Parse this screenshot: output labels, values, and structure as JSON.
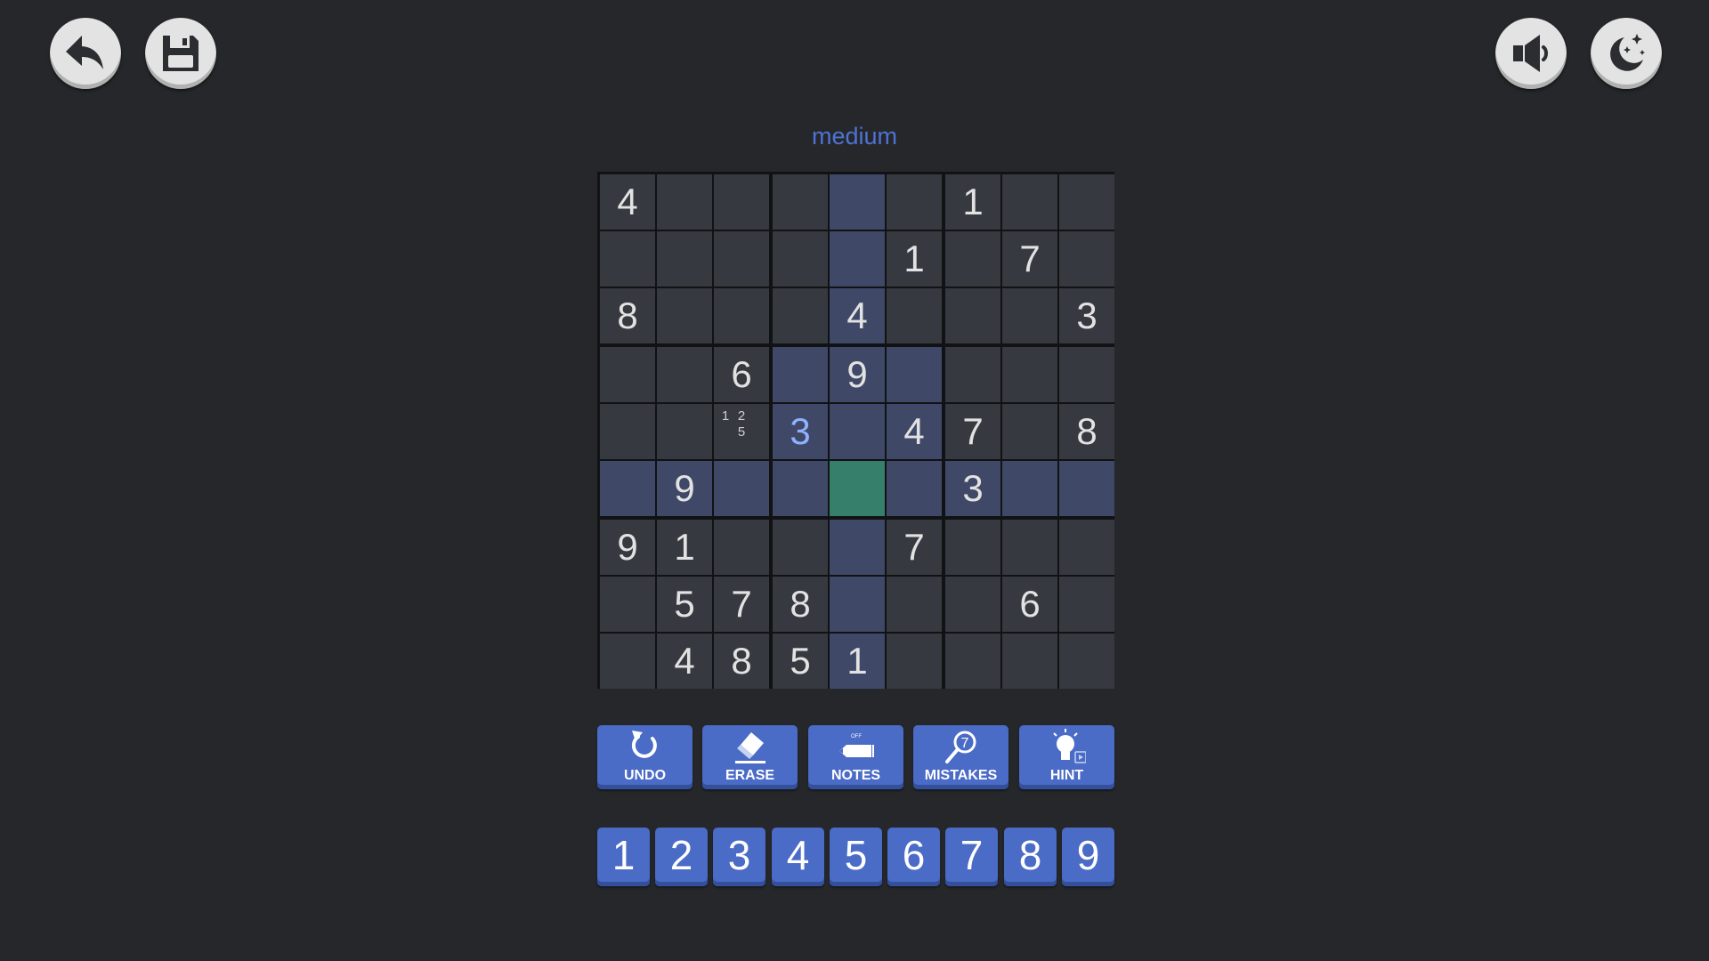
{
  "difficulty": "medium",
  "top_buttons": {
    "left": [
      {
        "name": "back-button",
        "icon": "back-arrow-icon"
      },
      {
        "name": "save-button",
        "icon": "floppy-disk-icon"
      }
    ],
    "right": [
      {
        "name": "sound-button",
        "icon": "speaker-icon"
      },
      {
        "name": "night-mode-button",
        "icon": "moon-stars-icon"
      }
    ]
  },
  "board": {
    "rows": [
      [
        "4",
        "",
        "",
        "",
        "",
        "",
        "1",
        "",
        ""
      ],
      [
        "",
        "",
        "",
        "",
        "",
        "1",
        "",
        "7",
        ""
      ],
      [
        "8",
        "",
        "",
        "",
        "4",
        "",
        "",
        "",
        "3"
      ],
      [
        "",
        "",
        "6",
        "",
        "9",
        "",
        "",
        "",
        ""
      ],
      [
        "",
        "",
        "",
        "3",
        "",
        "4",
        "7",
        "",
        "8"
      ],
      [
        "",
        "9",
        "",
        "",
        "",
        "",
        "3",
        "",
        ""
      ],
      [
        "9",
        "1",
        "",
        "",
        "",
        "7",
        "",
        "",
        ""
      ],
      [
        "",
        "5",
        "7",
        "8",
        "",
        "",
        "",
        "6",
        ""
      ],
      [
        "",
        "4",
        "8",
        "5",
        "1",
        "",
        "",
        "",
        ""
      ]
    ],
    "selected": [
      5,
      4
    ],
    "user_entered": [
      [
        4,
        3
      ]
    ],
    "notes": [
      {
        "cell": [
          4,
          2
        ],
        "values": [
          "1",
          "2",
          "5"
        ]
      }
    ]
  },
  "toolbar": [
    {
      "label": "UNDO",
      "icon": "undo-icon"
    },
    {
      "label": "ERASE",
      "icon": "eraser-icon"
    },
    {
      "label": "NOTES",
      "icon": "pencil-icon",
      "state": "OFF"
    },
    {
      "label": "MISTAKES",
      "icon": "magnifier-icon",
      "count": "7"
    },
    {
      "label": "HINT",
      "icon": "lightbulb-icon"
    }
  ],
  "numpad": [
    "1",
    "2",
    "3",
    "4",
    "5",
    "6",
    "7",
    "8",
    "9"
  ],
  "colors": {
    "background": "#25272b",
    "cell": "#36393f",
    "highlight": "#3f4867",
    "selected": "#36806b",
    "accent": "#4a6bc6",
    "user_digit": "#8fb1ff",
    "difficulty": "#4f73d4"
  }
}
